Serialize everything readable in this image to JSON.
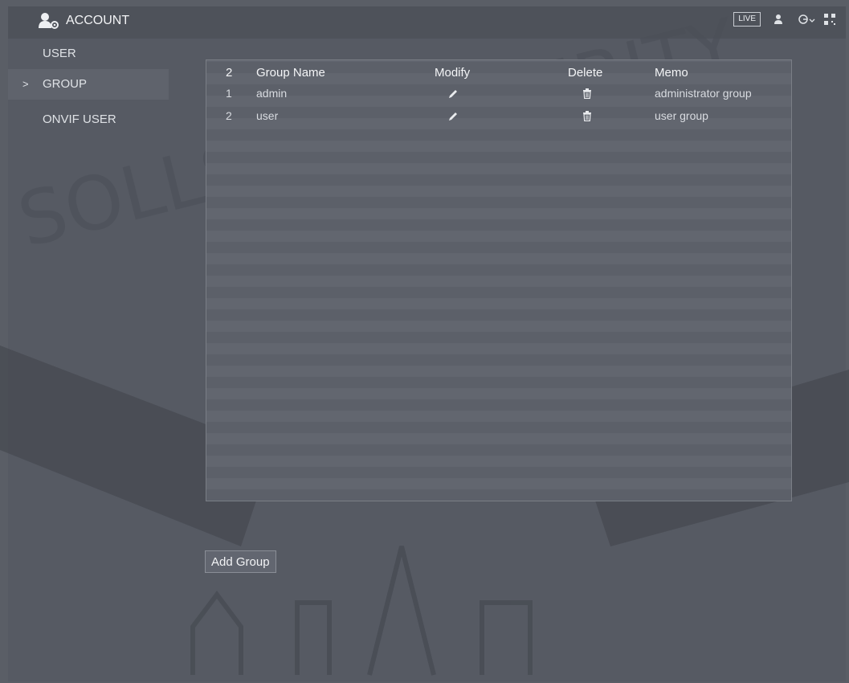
{
  "header": {
    "title": "ACCOUNT",
    "live_label": "LIVE"
  },
  "sidebar": {
    "items": [
      {
        "label": "USER"
      },
      {
        "label": "GROUP",
        "active": true
      },
      {
        "label": "ONVIF USER"
      }
    ]
  },
  "table": {
    "count": "2",
    "headers": {
      "name": "Group Name",
      "modify": "Modify",
      "delete": "Delete",
      "memo": "Memo"
    },
    "rows": [
      {
        "no": "1",
        "name": "admin",
        "memo": "administrator group"
      },
      {
        "no": "2",
        "name": "user",
        "memo": "user group"
      }
    ]
  },
  "actions": {
    "add_group": "Add Group"
  },
  "watermark": {
    "text": "SOLLSAM SECURITY"
  },
  "colors": {
    "background": "#5a5e66",
    "panel": "#565a63",
    "text": "#e6e8ec"
  }
}
